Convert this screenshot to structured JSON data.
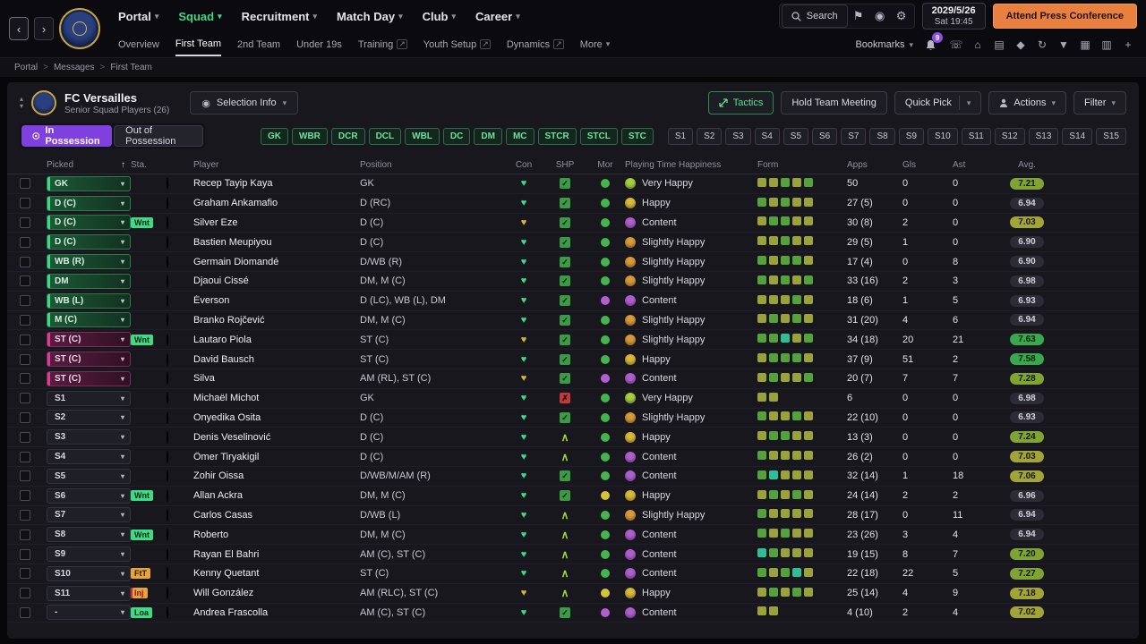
{
  "topnav": {
    "menus": [
      {
        "label": "Portal"
      },
      {
        "label": "Squad",
        "active": true
      },
      {
        "label": "Recruitment"
      },
      {
        "label": "Match Day"
      },
      {
        "label": "Club"
      },
      {
        "label": "Career"
      }
    ],
    "search_label": "Search",
    "date_line1": "2029/5/26",
    "date_line2": "Sat 19:45",
    "press_button": "Attend Press Conference"
  },
  "subnav": {
    "items": [
      {
        "label": "Overview"
      },
      {
        "label": "First Team",
        "active": true
      },
      {
        "label": "2nd Team"
      },
      {
        "label": "Under 19s"
      },
      {
        "label": "Training",
        "ext": true
      },
      {
        "label": "Youth Setup",
        "ext": true
      },
      {
        "label": "Dynamics",
        "ext": true
      },
      {
        "label": "More",
        "caret": true
      }
    ],
    "bookmarks_label": "Bookmarks",
    "bell_badge": "9",
    "icons": [
      {
        "name": "phone-icon",
        "glyph": "☏"
      },
      {
        "name": "stadium-icon",
        "glyph": "⌂"
      },
      {
        "name": "notes-icon",
        "glyph": "▤"
      },
      {
        "name": "analysis-icon",
        "glyph": "◆"
      },
      {
        "name": "refresh-icon",
        "glyph": "↻"
      },
      {
        "name": "funnel-icon",
        "glyph": "▼"
      },
      {
        "name": "calendar-icon",
        "glyph": "▦"
      },
      {
        "name": "grid-icon",
        "glyph": "▥"
      },
      {
        "name": "medical-icon",
        "glyph": "+"
      }
    ]
  },
  "breadcrumb": [
    "Portal",
    "Messages",
    "First Team"
  ],
  "header": {
    "club_name": "FC Versailles",
    "subtitle": "Senior Squad Players (26)",
    "selection_info": "Selection Info",
    "tactics": "Tactics",
    "hold_team_meeting": "Hold Team Meeting",
    "quick_pick": "Quick Pick",
    "actions": "Actions",
    "filter": "Filter"
  },
  "toolbar": {
    "in_possession": "In Possession",
    "out_of_possession": "Out of Possession",
    "position_filters": [
      "GK",
      "WBR",
      "DCR",
      "DCL",
      "WBL",
      "DC",
      "DM",
      "MC",
      "STCR",
      "STCL",
      "STC"
    ],
    "slot_filters": [
      "S1",
      "S2",
      "S3",
      "S4",
      "S5",
      "S6",
      "S7",
      "S8",
      "S9",
      "S10",
      "S11",
      "S12",
      "S13",
      "S14",
      "S15"
    ]
  },
  "table": {
    "columns": [
      "Picked",
      "Sta.",
      "Player",
      "Position",
      "Con",
      "SHP",
      "Mor",
      "Playing Time Happiness",
      "Form",
      "Apps",
      "Gls",
      "Ast",
      "Avg."
    ],
    "rows": [
      {
        "picked": "GK",
        "ptype": "g",
        "sta": null,
        "player": "Recep Tayip Kaya",
        "position": "GK",
        "con": "green",
        "shp": "check",
        "mor": "green",
        "hap": "veryhappy",
        "hlabel": "Very Happy",
        "form": [
          "olive",
          "olive",
          "green",
          "olive",
          "green"
        ],
        "apps": "50",
        "gls": "0",
        "ast": "0",
        "avg": "7.21"
      },
      {
        "picked": "D (C)",
        "ptype": "g",
        "sta": null,
        "player": "Graham Ankamafio",
        "position": "D (RC)",
        "con": "green",
        "shp": "check",
        "mor": "green",
        "hap": "happy",
        "hlabel": "Happy",
        "form": [
          "green",
          "olive",
          "green",
          "olive",
          "olive"
        ],
        "apps": "27 (5)",
        "gls": "0",
        "ast": "0",
        "avg": "6.94"
      },
      {
        "picked": "D (C)",
        "ptype": "g",
        "sta": {
          "label": "Wnt",
          "type": "st-g"
        },
        "player": "Silver Eze",
        "position": "D (C)",
        "con": "yellow",
        "shp": "check",
        "mor": "green",
        "hap": "content",
        "hlabel": "Content",
        "form": [
          "olive",
          "green",
          "green",
          "olive",
          "olive"
        ],
        "apps": "30 (8)",
        "gls": "2",
        "ast": "0",
        "avg": "7.03"
      },
      {
        "picked": "D (C)",
        "ptype": "g",
        "sta": null,
        "player": "Bastien Meupiyou",
        "position": "D (C)",
        "con": "green",
        "shp": "check",
        "mor": "green",
        "hap": "slightly",
        "hlabel": "Slightly Happy",
        "form": [
          "olive",
          "olive",
          "green",
          "olive",
          "olive"
        ],
        "apps": "29 (5)",
        "gls": "1",
        "ast": "0",
        "avg": "6.90"
      },
      {
        "picked": "WB (R)",
        "ptype": "g",
        "sta": null,
        "player": "Germain Diomandé",
        "position": "D/WB (R)",
        "con": "green",
        "shp": "check",
        "mor": "green",
        "hap": "slightly",
        "hlabel": "Slightly Happy",
        "form": [
          "green",
          "olive",
          "green",
          "green",
          "olive"
        ],
        "apps": "17 (4)",
        "gls": "0",
        "ast": "8",
        "avg": "6.90"
      },
      {
        "picked": "DM",
        "ptype": "g",
        "sta": null,
        "player": "Djaoui Cissé",
        "position": "DM, M (C)",
        "con": "green",
        "shp": "check",
        "mor": "green",
        "hap": "slightly",
        "hlabel": "Slightly Happy",
        "form": [
          "green",
          "olive",
          "green",
          "olive",
          "green"
        ],
        "apps": "33 (16)",
        "gls": "2",
        "ast": "3",
        "avg": "6.98"
      },
      {
        "picked": "WB (L)",
        "ptype": "g",
        "sta": null,
        "player": "Éverson",
        "position": "D (LC), WB (L), DM",
        "con": "green",
        "shp": "check",
        "mor": "purple",
        "hap": "content",
        "hlabel": "Content",
        "form": [
          "olive",
          "olive",
          "olive",
          "green",
          "olive"
        ],
        "apps": "18 (6)",
        "gls": "1",
        "ast": "5",
        "avg": "6.93"
      },
      {
        "picked": "M (C)",
        "ptype": "g",
        "sta": null,
        "player": "Branko Rojčević",
        "position": "DM, M (C)",
        "con": "green",
        "shp": "check",
        "mor": "green",
        "hap": "slightly",
        "hlabel": "Slightly Happy",
        "form": [
          "olive",
          "green",
          "olive",
          "green",
          "olive"
        ],
        "apps": "31 (20)",
        "gls": "4",
        "ast": "6",
        "avg": "6.94"
      },
      {
        "picked": "ST (C)",
        "ptype": "p",
        "sta": {
          "label": "Wnt",
          "type": "st-g"
        },
        "player": "Lautaro Piola",
        "position": "ST (C)",
        "con": "yellow",
        "shp": "check",
        "mor": "green",
        "hap": "slightly",
        "hlabel": "Slightly Happy",
        "form": [
          "green",
          "green",
          "teal",
          "olive",
          "green"
        ],
        "apps": "34 (18)",
        "gls": "20",
        "ast": "21",
        "avg": "7.63"
      },
      {
        "picked": "ST (C)",
        "ptype": "p",
        "sta": null,
        "player": "David Bausch",
        "position": "ST (C)",
        "con": "green",
        "shp": "check",
        "mor": "green",
        "hap": "happy",
        "hlabel": "Happy",
        "form": [
          "olive",
          "green",
          "green",
          "green",
          "olive"
        ],
        "apps": "37 (9)",
        "gls": "51",
        "ast": "2",
        "avg": "7.58"
      },
      {
        "picked": "ST (C)",
        "ptype": "p",
        "sta": null,
        "player": "Silva",
        "position": "AM (RL), ST (C)",
        "con": "yellow",
        "shp": "check",
        "mor": "purple",
        "hap": "content",
        "hlabel": "Content",
        "form": [
          "olive",
          "green",
          "olive",
          "olive",
          "green"
        ],
        "apps": "20 (7)",
        "gls": "7",
        "ast": "7",
        "avg": "7.28"
      },
      {
        "picked": "S1",
        "ptype": "n",
        "sta": null,
        "player": "Michaël Michot",
        "position": "GK",
        "con": "green",
        "shp": "x",
        "mor": "green",
        "hap": "veryhappy",
        "hlabel": "Very Happy",
        "form": [
          "olive",
          "olive"
        ],
        "apps": "6",
        "gls": "0",
        "ast": "0",
        "avg": "6.98"
      },
      {
        "picked": "S2",
        "ptype": "n",
        "sta": null,
        "player": "Onyedika Osita",
        "position": "D (C)",
        "con": "green",
        "shp": "check",
        "mor": "green",
        "hap": "slightly",
        "hlabel": "Slightly Happy",
        "form": [
          "green",
          "olive",
          "olive",
          "green",
          "olive"
        ],
        "apps": "22 (10)",
        "gls": "0",
        "ast": "0",
        "avg": "6.93"
      },
      {
        "picked": "S3",
        "ptype": "n",
        "sta": null,
        "player": "Denis Veselinović",
        "position": "D (C)",
        "con": "green",
        "shp": "up",
        "mor": "green",
        "hap": "happy",
        "hlabel": "Happy",
        "form": [
          "olive",
          "green",
          "green",
          "olive",
          "olive"
        ],
        "apps": "13 (3)",
        "gls": "0",
        "ast": "0",
        "avg": "7.24"
      },
      {
        "picked": "S4",
        "ptype": "n",
        "sta": null,
        "player": "Ömer Tiryakigil",
        "position": "D (C)",
        "con": "green",
        "shp": "up",
        "mor": "green",
        "hap": "content",
        "hlabel": "Content",
        "form": [
          "green",
          "olive",
          "olive",
          "olive",
          "olive"
        ],
        "apps": "26 (2)",
        "gls": "0",
        "ast": "0",
        "avg": "7.03"
      },
      {
        "picked": "S5",
        "ptype": "n",
        "sta": null,
        "player": "Zohir Oissa",
        "position": "D/WB/M/AM (R)",
        "con": "green",
        "shp": "check",
        "mor": "green",
        "hap": "content",
        "hlabel": "Content",
        "form": [
          "green",
          "teal",
          "olive",
          "olive",
          "olive"
        ],
        "apps": "32 (14)",
        "gls": "1",
        "ast": "18",
        "avg": "7.06"
      },
      {
        "picked": "S6",
        "ptype": "n",
        "sta": {
          "label": "Wnt",
          "type": "st-g"
        },
        "player": "Allan Ackra",
        "position": "DM, M (C)",
        "con": "green",
        "shp": "check",
        "mor": "yellow",
        "hap": "happy",
        "hlabel": "Happy",
        "form": [
          "olive",
          "green",
          "olive",
          "green",
          "olive"
        ],
        "apps": "24 (14)",
        "gls": "2",
        "ast": "2",
        "avg": "6.96"
      },
      {
        "picked": "S7",
        "ptype": "n",
        "sta": null,
        "player": "Carlos Casas",
        "position": "D/WB (L)",
        "con": "green",
        "shp": "up",
        "mor": "green",
        "hap": "slightly",
        "hlabel": "Slightly Happy",
        "form": [
          "green",
          "olive",
          "olive",
          "olive",
          "olive"
        ],
        "apps": "28 (17)",
        "gls": "0",
        "ast": "11",
        "avg": "6.94"
      },
      {
        "picked": "S8",
        "ptype": "n",
        "sta": {
          "label": "Wnt",
          "type": "st-g"
        },
        "player": "Roberto",
        "position": "DM, M (C)",
        "con": "green",
        "shp": "up",
        "mor": "green",
        "hap": "content",
        "hlabel": "Content",
        "form": [
          "green",
          "olive",
          "green",
          "olive",
          "olive"
        ],
        "apps": "23 (26)",
        "gls": "3",
        "ast": "4",
        "avg": "6.94"
      },
      {
        "picked": "S9",
        "ptype": "n",
        "sta": null,
        "player": "Rayan El Bahri",
        "position": "AM (C), ST (C)",
        "con": "green",
        "shp": "up",
        "mor": "green",
        "hap": "content",
        "hlabel": "Content",
        "form": [
          "teal",
          "green",
          "olive",
          "olive",
          "olive"
        ],
        "apps": "19 (15)",
        "gls": "8",
        "ast": "7",
        "avg": "7.20"
      },
      {
        "picked": "S10",
        "ptype": "n",
        "sta": {
          "label": "FtT",
          "type": "st-o"
        },
        "player": "Kenny Quetant",
        "position": "ST (C)",
        "con": "green",
        "shp": "up",
        "mor": "green",
        "hap": "content",
        "hlabel": "Content",
        "form": [
          "green",
          "olive",
          "green",
          "teal",
          "olive"
        ],
        "apps": "22 (18)",
        "gls": "22",
        "ast": "5",
        "avg": "7.27"
      },
      {
        "picked": "S11",
        "ptype": "n",
        "sta": {
          "label": "Inj",
          "type": "st-i"
        },
        "player": "Will González",
        "position": "AM (RLC), ST (C)",
        "con": "yellow",
        "shp": "up",
        "mor": "yellow",
        "hap": "happy",
        "hlabel": "Happy",
        "form": [
          "olive",
          "green",
          "olive",
          "green",
          "olive"
        ],
        "apps": "25 (14)",
        "gls": "4",
        "ast": "9",
        "avg": "7.18"
      },
      {
        "picked": "-",
        "ptype": "n",
        "sta": {
          "label": "Loa",
          "type": "st-g"
        },
        "player": "Andrea Frascolla",
        "position": "AM (C), ST (C)",
        "con": "green",
        "shp": "check",
        "mor": "purple",
        "hap": "content",
        "hlabel": "Content",
        "form": [
          "olive",
          "olive"
        ],
        "apps": "4 (10)",
        "gls": "2",
        "ast": "4",
        "avg": "7.02"
      }
    ]
  },
  "palette": {
    "accent_green": "#3dd68c",
    "accent_purple": "#8040e0",
    "accent_orange": "#e8813f",
    "con": {
      "green": "#3ddc84",
      "yellow": "#d8b23a"
    },
    "mor": {
      "green": "#46b44e",
      "yellow": "#d4c23a",
      "purple": "#b05fd0"
    },
    "hap": {
      "veryhappy": "#a4cf3e",
      "happy": "#d8b93a",
      "slightly": "#d89a3a",
      "content": "#b05fd0"
    },
    "form": {
      "olive": "#9aa23c",
      "green": "#55a23c",
      "teal": "#2fbf96"
    }
  }
}
